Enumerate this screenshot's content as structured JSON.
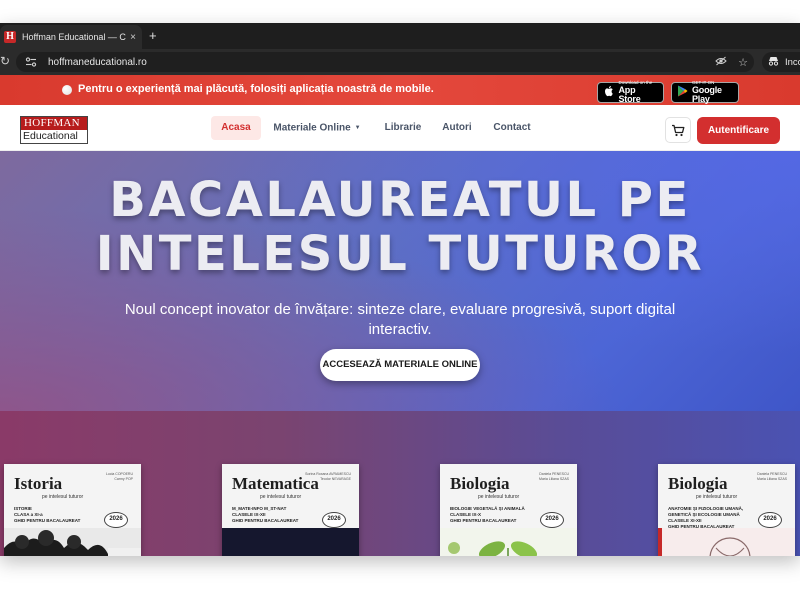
{
  "browser": {
    "tab_title": "Hoffman Educational — Carti",
    "tab_close": "×",
    "new_tab": "+",
    "url": "hoffmaneducational.ro",
    "profile_label": "Incog",
    "icons": [
      "reload-icon",
      "site-settings-icon",
      "eye-off-icon",
      "star-icon",
      "incognito-icon"
    ]
  },
  "banner": {
    "text": "Pentru o experiență mai plăcută, folosiți aplicația noastră de mobile.",
    "app_store_small": "Download on the",
    "app_store_big": "App Store",
    "google_play_small": "GET IT ON",
    "google_play_big": "Google Play",
    "color": "#e4483c"
  },
  "nav": {
    "logo_top": "HOFFMAN",
    "logo_bottom": "Educational",
    "items": [
      {
        "label": "Acasa",
        "active": true
      },
      {
        "label": "Materiale Online",
        "active": false,
        "has_dropdown": true
      },
      {
        "label": "Librarie",
        "active": false
      },
      {
        "label": "Autori",
        "active": false
      },
      {
        "label": "Contact",
        "active": false
      }
    ],
    "dropdown_caret": "▼",
    "login_label": "Autentificare",
    "accent": "#d32f2f"
  },
  "hero": {
    "title_line1": "BACALAUREATUL PE",
    "title_line2": "INTELESUL TUTUROR",
    "subtitle": "Noul concept inovator de învățare: sinteze clare, evaluare progresivă, suport digital interactiv.",
    "cta_label": "ACCESEAZĂ MATERIALE ONLINE"
  },
  "books": [
    {
      "title": "Istoria",
      "tag": "pe intelesul tuturor",
      "authors": "Lucia COPOERU\nCarmy POP",
      "info": "ISTORIE\nCLASA a XI-a\nGHID PENTRU BACALAUREAT",
      "year": "2026",
      "accent": "#444444"
    },
    {
      "title": "Matematica",
      "tag": "pe intelesul tuturor",
      "authors": "Sorina Roxana AVRAMESCU\nTeodor NEVARAGE",
      "info": "M_MATE-INFO   M_ST-NAT\nCLASELE IX-XII\nGHID PENTRU BACALAUREAT",
      "year": "2026",
      "accent": "#1a1f3a"
    },
    {
      "title": "Biologia",
      "tag": "pe intelesul tuturor",
      "authors": "Daniela PENESCU\nMaria Liliana SZAS",
      "info": "BIOLOGIE VEGETALĂ ȘI ANIMALĂ\nCLASELE IX-X\nGHID PENTRU BACALAUREAT",
      "year": "2026",
      "accent": "#7cb342"
    },
    {
      "title": "Biologia",
      "tag": "pe intelesul tuturor",
      "authors": "Daniela PENESCU\nMaria Liliana SZAS",
      "info": "ANATOMIE ȘI FIZIOLOGIE UMANĂ,\nGENETICĂ ȘI ECOLOGIE UMANĂ\nCLASELE XI-XII\nGHID PENTRU BACALAUREAT",
      "year": "2026",
      "accent": "#c62828"
    }
  ]
}
